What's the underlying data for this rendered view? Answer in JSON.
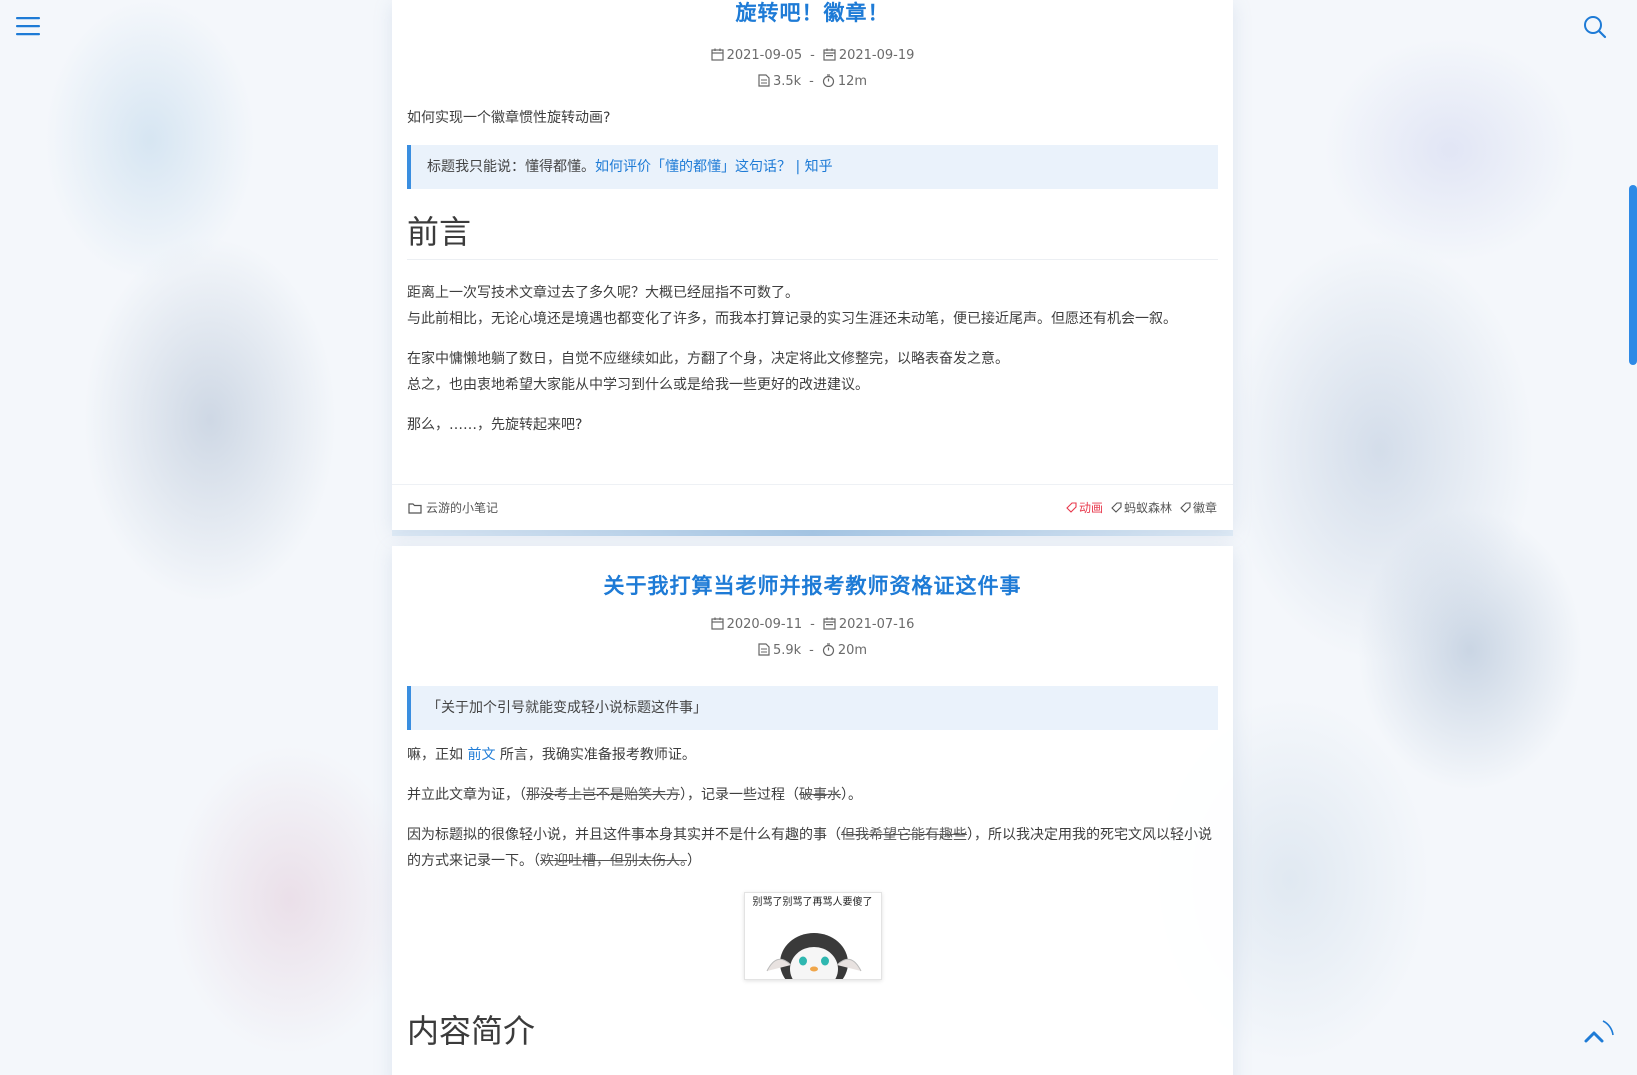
{
  "posts": [
    {
      "title": "旋转吧！徽章！",
      "created": "2021-09-05",
      "updated": "2021-09-19",
      "words": "3.5k",
      "read_time": "12m",
      "intro": "如何实现一个徽章惯性旋转动画?",
      "quote_text": "标题我只能说：懂得都懂。",
      "quote_link": "如何评价「懂的都懂」这句话？ | 知乎",
      "heading": "前言",
      "para1_line1": "距离上一次写技术文章过去了多久呢？大概已经屈指不可数了。",
      "para1_line2": "与此前相比，无论心境还是境遇也都变化了许多，而我本打算记录的实习生涯还未动笔，便已接近尾声。但愿还有机会一叙。",
      "para2_line1": "在家中慵懒地躺了数日，自觉不应继续如此，方翻了个身，决定将此文修整完，以略表奋发之意。",
      "para2_line2": "总之，也由衷地希望大家能从中学习到什么或是给我一些更好的改进建议。",
      "para3": "那么，……，先旋转起来吧?",
      "category": "云游的小笔记",
      "tags": [
        "动画",
        "蚂蚁森林",
        "徽章"
      ]
    },
    {
      "title": "关于我打算当老师并报考教师资格证这件事",
      "created": "2020-09-11",
      "updated": "2021-07-16",
      "words": "5.9k",
      "read_time": "20m",
      "quote_text": "「关于加个引号就能变成轻小说标题这件事」",
      "p1_a": "嘛，正如",
      "p1_link": "前文",
      "p1_b": "所言，我确实准备报考教师证。",
      "p2_a": "并立此文章为证，（",
      "p2_strike1": "那没考上岂不是贻笑大方",
      "p2_b": "），记录一些过程（",
      "p2_strike2": "破事水",
      "p2_c": "）。",
      "p3_a": "因为标题拟的很像轻小说，并且这件事本身其实并不是什么有趣的事（",
      "p3_strike1": "但我希望它能有趣些",
      "p3_b": "），所以我决定用我的死宅文风以轻小说的方式来记录一下。（",
      "p3_strike2": "欢迎吐槽，但别太伤人。",
      "p3_c": "）",
      "sticker_caption": "别骂了别骂了再骂人要傻了",
      "heading": "内容简介"
    }
  ],
  "icons": {
    "menu": "menu-icon",
    "search": "search-icon",
    "back_to_top": "chevron-up-icon"
  },
  "colors": {
    "accent": "#1e7bd6",
    "hot_tag": "#e8394d",
    "quote_bg": "#eaf2fb"
  }
}
